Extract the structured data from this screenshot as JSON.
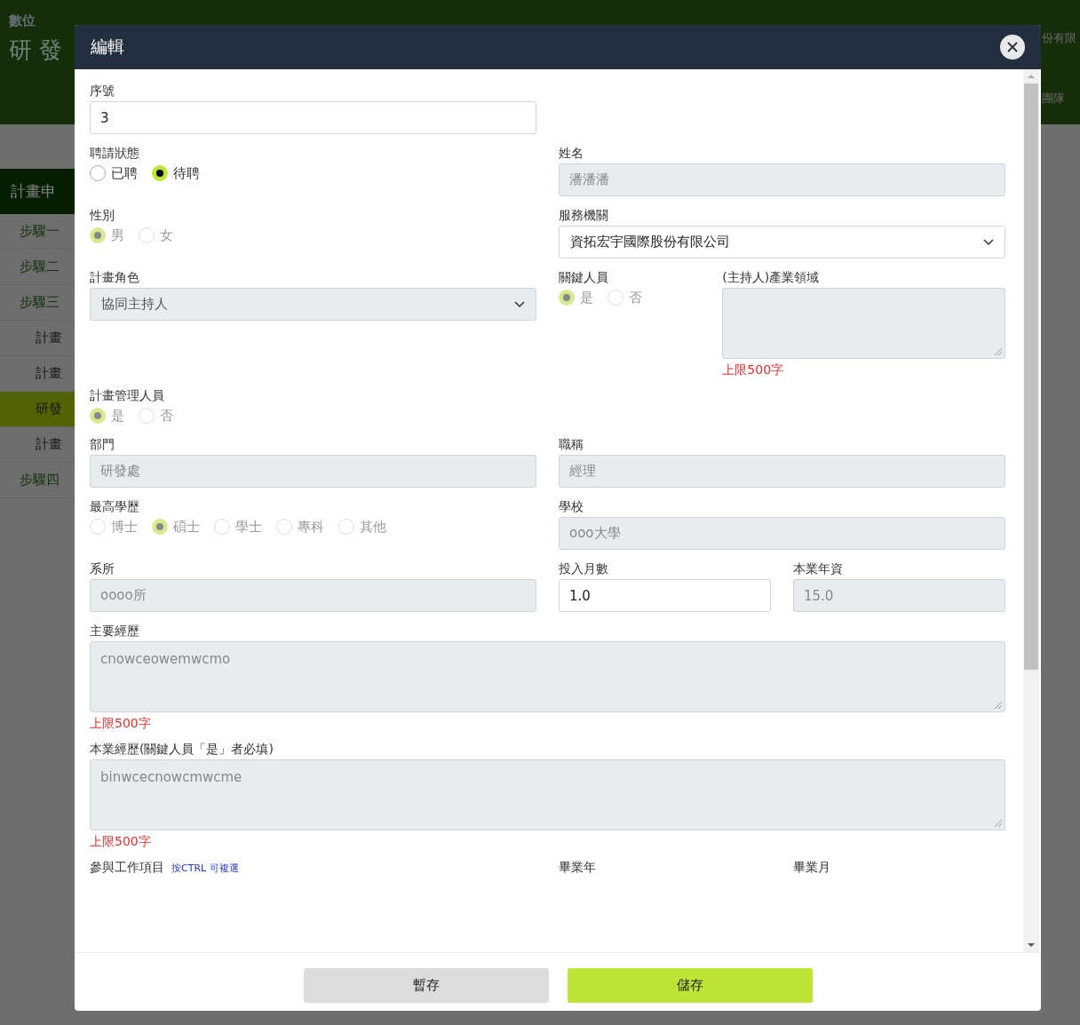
{
  "page": {
    "logo_text": "數位",
    "title": "研 發",
    "right_texts": [
      "份有限",
      "團隊"
    ],
    "sidebar": {
      "heading": "計畫申",
      "items": [
        {
          "label": "步驟一",
          "kind": "step",
          "selected": false
        },
        {
          "label": "步驟二",
          "kind": "step",
          "selected": false
        },
        {
          "label": "步驟三",
          "kind": "step",
          "selected": false
        },
        {
          "label": "計畫",
          "kind": "sub",
          "selected": false
        },
        {
          "label": "計畫",
          "kind": "sub",
          "selected": false
        },
        {
          "label": "研發",
          "kind": "sub",
          "selected": true
        },
        {
          "label": "計畫",
          "kind": "sub",
          "selected": false
        },
        {
          "label": "步驟四",
          "kind": "step",
          "selected": false
        }
      ]
    }
  },
  "modal": {
    "title": "編輯",
    "rows": [
      {
        "fields": [
          {
            "kind": "input",
            "label": "序號",
            "value": "3",
            "disabled": false
          }
        ]
      },
      {
        "fields": [
          {
            "kind": "radio",
            "label": "聘請狀態",
            "disabled": false,
            "options": [
              {
                "label": "已聘",
                "selected": false
              },
              {
                "label": "待聘",
                "selected": true
              }
            ]
          },
          {
            "kind": "input",
            "label": "姓名",
            "value": "潘潘潘",
            "disabled": true
          }
        ]
      },
      {
        "fields": [
          {
            "kind": "radio",
            "label": "性別",
            "disabled": true,
            "options": [
              {
                "label": "男",
                "selected": true
              },
              {
                "label": "女",
                "selected": false
              }
            ]
          },
          {
            "kind": "select",
            "label": "服務機關",
            "value": "資拓宏宇國際股份有限公司",
            "disabled": false
          }
        ]
      },
      {
        "fields": [
          {
            "kind": "select",
            "label": "計畫角色",
            "value": "協同主持人",
            "disabled": true
          },
          {
            "kind": "radio",
            "label": "關鍵人員",
            "disabled": true,
            "options": [
              {
                "label": "是",
                "selected": true
              },
              {
                "label": "否",
                "selected": false
              }
            ]
          },
          {
            "kind": "textarea",
            "label": "(主持人)產業領域",
            "disabled": true,
            "note": "上限500字"
          }
        ]
      },
      {
        "fields": [
          {
            "kind": "radio",
            "label": "計畫管理人員",
            "disabled": true,
            "options": [
              {
                "label": "是",
                "selected": true
              },
              {
                "label": "否",
                "selected": false
              }
            ]
          }
        ]
      },
      {
        "fields": [
          {
            "kind": "input",
            "label": "部門",
            "value": "研發處",
            "disabled": true
          },
          {
            "kind": "input",
            "label": "職稱",
            "value": "經理",
            "disabled": true
          }
        ]
      },
      {
        "fields": [
          {
            "kind": "radio",
            "label": "最高學歷",
            "disabled": true,
            "options": [
              {
                "label": "博士",
                "selected": false
              },
              {
                "label": "碩士",
                "selected": true
              },
              {
                "label": "學士",
                "selected": false
              },
              {
                "label": "專科",
                "selected": false
              },
              {
                "label": "其他",
                "selected": false
              }
            ]
          },
          {
            "kind": "input",
            "label": "學校",
            "value": "ooo大學",
            "disabled": true
          }
        ]
      },
      {
        "fields": [
          {
            "kind": "input",
            "label": "系所",
            "value": "oooo所",
            "disabled": true
          },
          {
            "kind": "input",
            "label": "投入月數",
            "value": "1.0",
            "disabled": false
          },
          {
            "kind": "input",
            "label": "本業年資",
            "value": "15.0",
            "disabled": true
          }
        ]
      },
      {
        "fields": [
          {
            "kind": "textarea",
            "label": "主要經歷",
            "value": "cnowceowemwcmo",
            "disabled": true,
            "note": "上限500字"
          }
        ]
      },
      {
        "fields": [
          {
            "kind": "textarea",
            "label": "本業經歷(關鍵人員「是」者必填)",
            "value": "binwcecnowcmwcme",
            "disabled": true,
            "note": "上限500字"
          }
        ]
      },
      {
        "fields": [
          {
            "kind": "heading",
            "label": "參與工作項目",
            "hint": "按CTRL 可複選"
          },
          {
            "kind": "heading",
            "label": "畢業年"
          },
          {
            "kind": "heading",
            "label": "畢業月"
          }
        ]
      }
    ],
    "buttons": [
      {
        "label": "暫存",
        "kind": "secondary"
      },
      {
        "label": "儲存",
        "kind": "primary"
      }
    ]
  }
}
